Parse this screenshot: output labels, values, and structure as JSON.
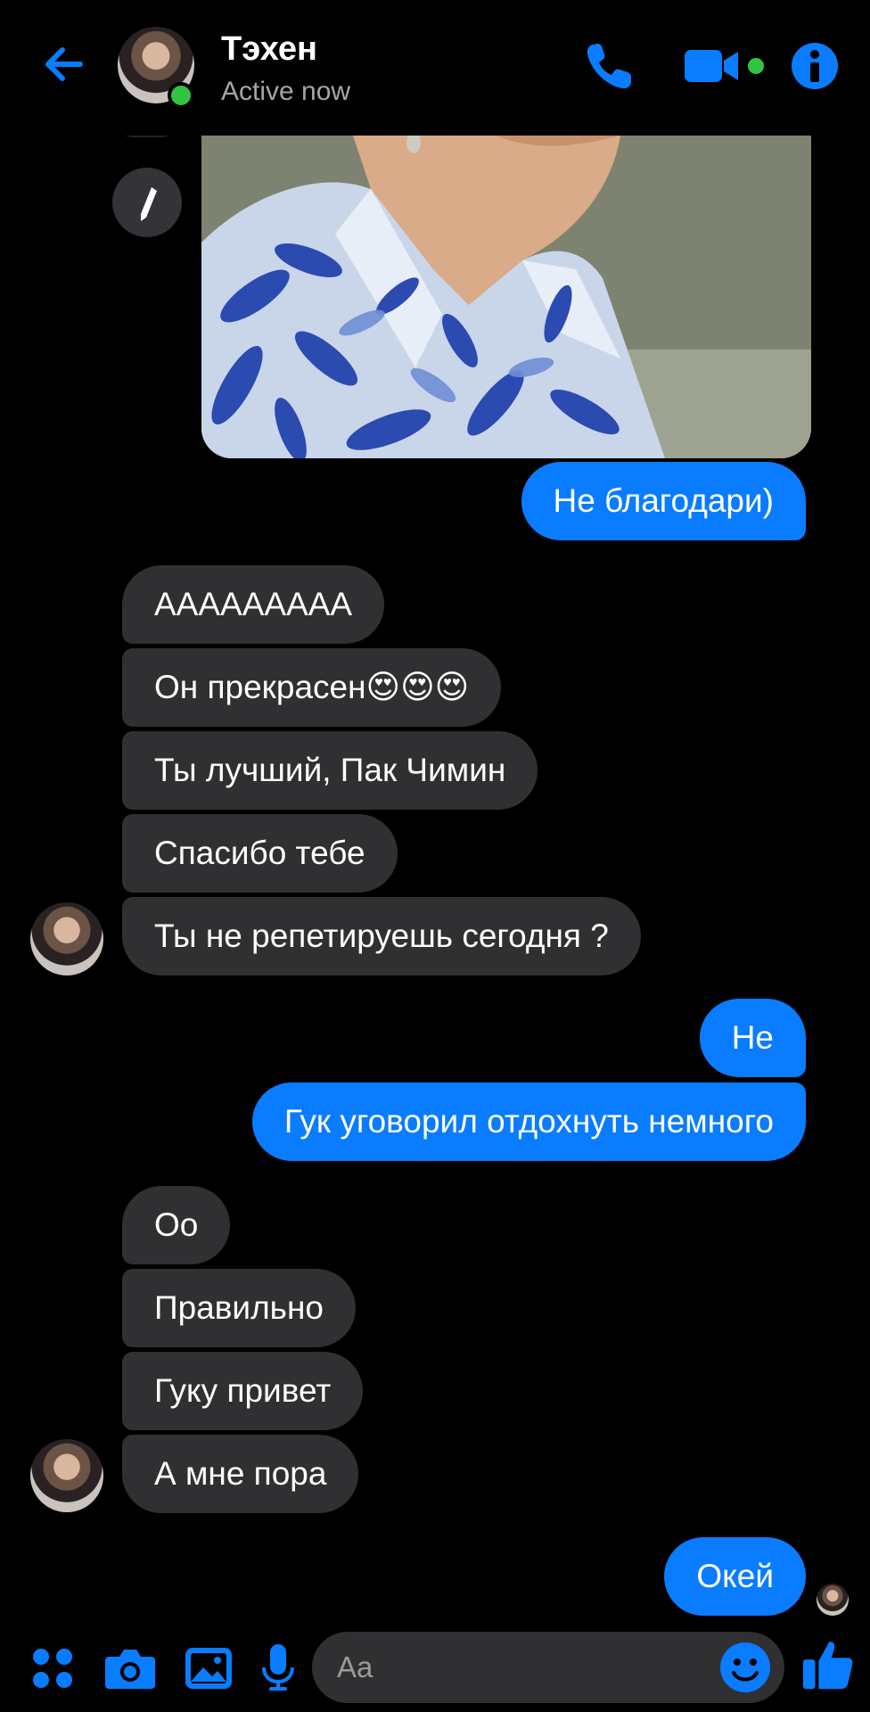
{
  "header": {
    "name": "Тэхен",
    "status": "Active now",
    "accent": "#0a7cff",
    "online_color": "#31c440"
  },
  "messages": [
    {
      "dir": "out",
      "text": "Не благодари)"
    },
    {
      "dir": "in",
      "text": "ААААААААА"
    },
    {
      "dir": "in",
      "text": "Он прекрасен😍😍😍"
    },
    {
      "dir": "in",
      "text": "Ты лучший, Пак Чимин"
    },
    {
      "dir": "in",
      "text": "Спасибо тебе"
    },
    {
      "dir": "in",
      "text": "Ты не репетируешь сегодня ?"
    },
    {
      "dir": "out",
      "text": "Не"
    },
    {
      "dir": "out",
      "text": "Гук уговорил отдохнуть немного"
    },
    {
      "dir": "in",
      "text": "Оо"
    },
    {
      "dir": "in",
      "text": "Правильно"
    },
    {
      "dir": "in",
      "text": "Гуку привет"
    },
    {
      "dir": "in",
      "text": "А мне пора"
    },
    {
      "dir": "out",
      "text": "Окей"
    }
  ],
  "composer": {
    "placeholder": "Aa"
  },
  "icons": [
    "back-arrow-icon",
    "phone-icon",
    "video-camera-icon",
    "info-icon",
    "pencil-icon",
    "apps-grid-icon",
    "camera-icon",
    "image-icon",
    "microphone-icon",
    "emoji-icon",
    "thumbs-up-icon"
  ]
}
